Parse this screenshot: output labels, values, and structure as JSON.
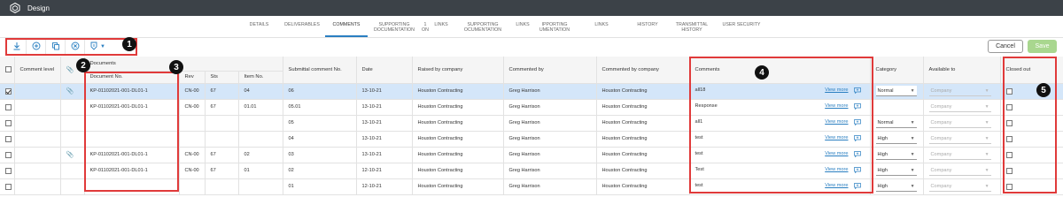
{
  "app": {
    "title": "Design"
  },
  "tabs": [
    {
      "label": "DETAILS",
      "active": false
    },
    {
      "label": "DELIVERABLES",
      "active": false
    },
    {
      "label": "COMMENTS",
      "active": true
    },
    {
      "label": "SUPPORTING\nDOCUMENTATION",
      "active": false
    },
    {
      "label": "1\nON",
      "active": false
    },
    {
      "label": "LINKS",
      "active": false
    },
    {
      "label": "SUPPORTING\nOCUMENTATION",
      "active": false
    },
    {
      "label": "LINKS",
      "active": false
    },
    {
      "label": "IPPORTING\nUMENTATION",
      "active": false
    },
    {
      "label": "LINKS",
      "active": false
    },
    {
      "label": "HISTORY",
      "active": false
    },
    {
      "label": "TRANSMITTAL\nHISTORY",
      "active": false
    },
    {
      "label": "USER SECURITY",
      "active": false
    }
  ],
  "toolbar": {
    "icons": [
      "download-icon",
      "add-icon",
      "copy-icon",
      "cancel-icon",
      "import-icon"
    ]
  },
  "actions": {
    "cancel": "Cancel",
    "save": "Save"
  },
  "table": {
    "headers": {
      "comment_level": "Comment level",
      "documents": "Documents",
      "document_no": "Document No.",
      "rev": "Rev",
      "sts": "Sts",
      "item_no": "Item No.",
      "submittal_comment_no": "Submittal comment No.",
      "date": "Date",
      "raised_by_company": "Raised by company",
      "commented_by": "Commented by",
      "commented_by_company": "Commented by company",
      "comments": "Comments",
      "category": "Category",
      "available_to": "Available to",
      "closed_out": "Closed out"
    },
    "view_more": "View more",
    "rows": [
      {
        "checked": true,
        "selected": true,
        "attachment": true,
        "document_no": "KP-01102021-001-DL01-1",
        "rev": "CN-00",
        "sts": "67",
        "item_no": "04",
        "submittal_comment_no": "06",
        "date": "13-10-21",
        "raised_by_company": "Houston Contracting",
        "commented_by": "Greg Harrison",
        "commented_by_company": "Houston Contracting",
        "comment": "all18",
        "category": "Normal",
        "available_to": "Company"
      },
      {
        "checked": false,
        "selected": false,
        "attachment": false,
        "document_no": "KP-01102021-001-DL01-1",
        "rev": "CN-00",
        "sts": "67",
        "item_no": "01.01",
        "submittal_comment_no": "05.01",
        "date": "13-10-21",
        "raised_by_company": "Houston Contracting",
        "commented_by": "Greg Harrison",
        "commented_by_company": "Houston Contracting",
        "comment": "Response",
        "category": "",
        "available_to": "Company"
      },
      {
        "checked": false,
        "selected": false,
        "attachment": false,
        "document_no": "",
        "rev": "",
        "sts": "",
        "item_no": "",
        "submittal_comment_no": "05",
        "date": "13-10-21",
        "raised_by_company": "Houston Contracting",
        "commented_by": "Greg Harrison",
        "commented_by_company": "Houston Contracting",
        "comment": "all1",
        "category": "Normal",
        "available_to": "Company"
      },
      {
        "checked": false,
        "selected": false,
        "attachment": false,
        "document_no": "",
        "rev": "",
        "sts": "",
        "item_no": "",
        "submittal_comment_no": "04",
        "date": "13-10-21",
        "raised_by_company": "Houston Contracting",
        "commented_by": "Greg Harrison",
        "commented_by_company": "Houston Contracting",
        "comment": "test",
        "category": "High",
        "available_to": "Company"
      },
      {
        "checked": false,
        "selected": false,
        "attachment": true,
        "document_no": "KP-01102021-001-DL01-1",
        "rev": "CN-00",
        "sts": "67",
        "item_no": "02",
        "submittal_comment_no": "03",
        "date": "13-10-21",
        "raised_by_company": "Houston Contracting",
        "commented_by": "Greg Harrison",
        "commented_by_company": "Houston Contracting",
        "comment": "test",
        "category": "High",
        "available_to": "Company"
      },
      {
        "checked": false,
        "selected": false,
        "attachment": false,
        "document_no": "KP-01102021-001-DL01-1",
        "rev": "CN-00",
        "sts": "67",
        "item_no": "01",
        "submittal_comment_no": "02",
        "date": "12-10-21",
        "raised_by_company": "Houston Contracting",
        "commented_by": "Greg Harrison",
        "commented_by_company": "Houston Contracting",
        "comment": "Test",
        "category": "High",
        "available_to": "Company"
      },
      {
        "checked": false,
        "selected": false,
        "attachment": false,
        "document_no": "",
        "rev": "",
        "sts": "",
        "item_no": "",
        "submittal_comment_no": "01",
        "date": "12-10-21",
        "raised_by_company": "Houston Contracting",
        "commented_by": "Greg Harrison",
        "commented_by_company": "Houston Contracting",
        "comment": "test",
        "category": "High",
        "available_to": "Company"
      }
    ]
  },
  "annotations": [
    "1",
    "2",
    "3",
    "4",
    "5"
  ],
  "colors": {
    "accent": "#2a7fc1",
    "highlight": "#e03a3a",
    "save": "#a9d78f",
    "topbar": "#3c4248",
    "selected_row": "#d4e6f9"
  }
}
